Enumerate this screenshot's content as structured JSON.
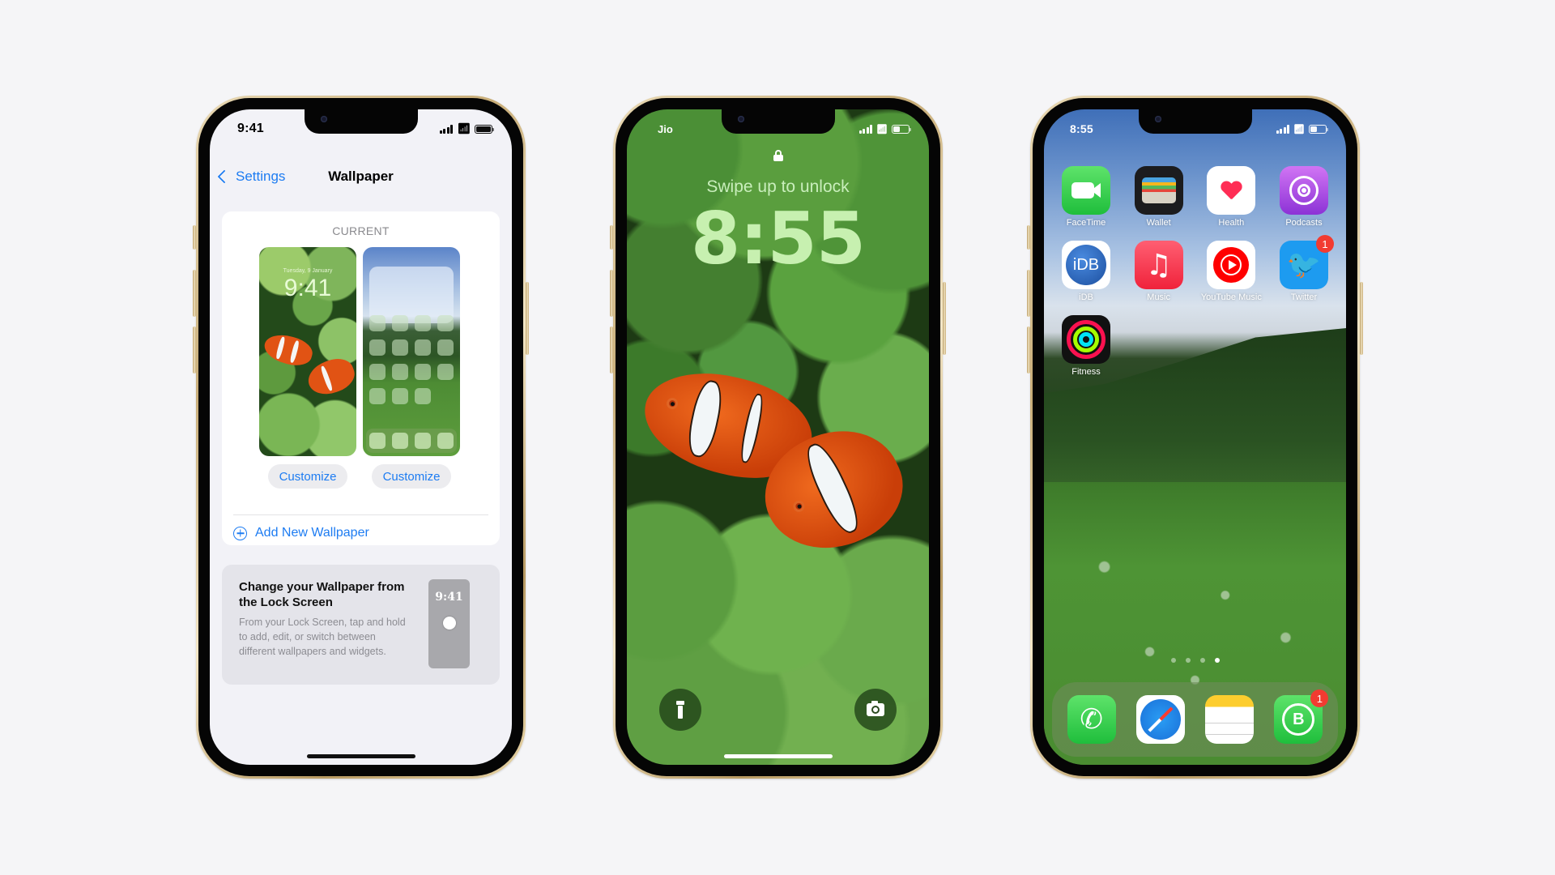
{
  "phones": {
    "settings": {
      "status": {
        "time": "9:41"
      },
      "nav": {
        "back_label": "Settings",
        "title": "Wallpaper"
      },
      "current_label": "CURRENT",
      "lock_preview": {
        "date": "Tuesday, 9 January",
        "time": "9:41"
      },
      "customize_left": "Customize",
      "customize_right": "Customize",
      "add_new": "Add New Wallpaper",
      "info": {
        "title": "Change your Wallpaper from the Lock Screen",
        "body": "From your Lock Screen, tap and hold to add, edit, or switch between different wallpapers and widgets.",
        "preview_time": "9:41"
      }
    },
    "lock": {
      "status": {
        "carrier": "Jio"
      },
      "swipe_text": "Swipe up to unlock",
      "time": "8:55",
      "buttons": {
        "left": "flashlight",
        "right": "camera"
      }
    },
    "home": {
      "status": {
        "time": "8:55"
      },
      "apps": [
        {
          "label": "FaceTime",
          "icon": "facetime-icon"
        },
        {
          "label": "Wallet",
          "icon": "wallet-icon"
        },
        {
          "label": "Health",
          "icon": "health-icon"
        },
        {
          "label": "Podcasts",
          "icon": "podcasts-icon"
        },
        {
          "label": "iDB",
          "icon": "idb-icon",
          "glyph": "iDB"
        },
        {
          "label": "Music",
          "icon": "music-icon",
          "glyph": "♫"
        },
        {
          "label": "YouTube Music",
          "icon": "youtube-music-icon"
        },
        {
          "label": "Twitter",
          "icon": "twitter-icon",
          "glyph": "🐦",
          "badge": "1"
        },
        {
          "label": "Fitness",
          "icon": "fitness-icon"
        }
      ],
      "page_indicator": {
        "pages": 4,
        "current": 4
      },
      "dock": [
        {
          "name": "Phone",
          "icon": "phone-icon",
          "glyph": "✆"
        },
        {
          "name": "Safari",
          "icon": "safari-icon"
        },
        {
          "name": "Notes",
          "icon": "notes-icon"
        },
        {
          "name": "WhatsApp Business",
          "icon": "whatsapp-business-icon",
          "glyph": "B",
          "badge": "1"
        }
      ]
    }
  },
  "colors": {
    "accent_blue": "#1d7cf2",
    "frame_gold": "#c8ad78",
    "badge_red": "#f23b31",
    "background": "#f5f5f7"
  }
}
